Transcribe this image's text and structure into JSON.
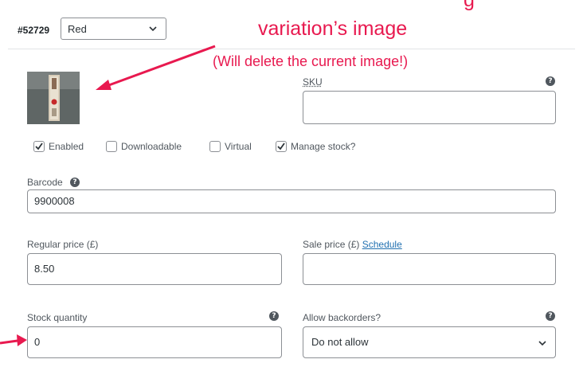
{
  "variation": {
    "id": "#52729",
    "attribute_value": "Red"
  },
  "callout": {
    "title_top": "g",
    "title": "variation’s image",
    "subtitle": "(Will delete the current image!)",
    "color": "#e8194f"
  },
  "sku": {
    "label": "SKU",
    "value": ""
  },
  "checkboxes": {
    "enabled": {
      "label": "Enabled",
      "checked": true
    },
    "downloadable": {
      "label": "Downloadable",
      "checked": false
    },
    "virtual": {
      "label": "Virtual",
      "checked": false
    },
    "manage_stock": {
      "label": "Manage stock?",
      "checked": true
    }
  },
  "barcode": {
    "label": "Barcode",
    "value": "9900008"
  },
  "regular_price": {
    "label": "Regular price (£)",
    "value": "8.50"
  },
  "sale_price": {
    "label": "Sale price (£)",
    "link": "Schedule",
    "value": ""
  },
  "stock_quantity": {
    "label": "Stock quantity",
    "value": "0"
  },
  "backorders": {
    "label": "Allow backorders?",
    "value": "Do not allow"
  }
}
